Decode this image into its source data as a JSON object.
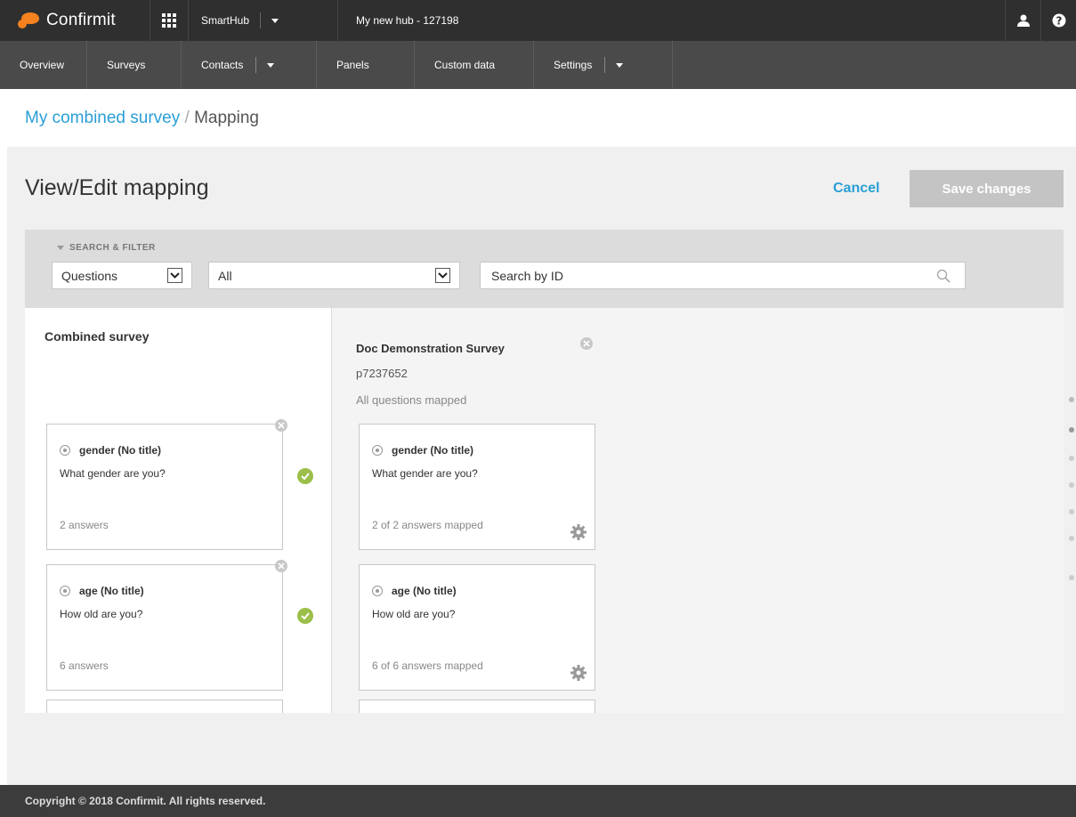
{
  "topbar": {
    "brand": "Confirmit",
    "hub_selector": "SmartHub",
    "hub_name": "My new hub - 127198",
    "icons": [
      "user-icon",
      "help-icon"
    ]
  },
  "nav": {
    "items": [
      {
        "label": "Overview",
        "has_dropdown": false
      },
      {
        "label": "Surveys",
        "has_dropdown": false
      },
      {
        "label": "Contacts",
        "has_dropdown": true
      },
      {
        "label": "Panels",
        "has_dropdown": false
      },
      {
        "label": "Custom data",
        "has_dropdown": false
      },
      {
        "label": "Settings",
        "has_dropdown": true
      }
    ]
  },
  "breadcrumb": {
    "link": "My combined survey",
    "separator": " / ",
    "current": "Mapping"
  },
  "page": {
    "title": "View/Edit mapping",
    "cancel_label": "Cancel",
    "save_label": "Save changes"
  },
  "filter": {
    "title": "SEARCH & FILTER",
    "type_select": "Questions",
    "scope_select": "All",
    "search_placeholder": "Search by ID"
  },
  "left": {
    "title": "Combined survey",
    "cards": [
      {
        "id": "gender (No title)",
        "text": "What gender are you?",
        "footer": "2 answers",
        "mapped": true
      },
      {
        "id": "age (No title)",
        "text": "How old are you?",
        "footer": "6 answers",
        "mapped": true
      }
    ]
  },
  "right": {
    "survey_name": "Doc Demonstration Survey",
    "survey_id": "p7237652",
    "status": "All questions mapped",
    "cards": [
      {
        "id": "gender (No title)",
        "text": "What gender are you?",
        "footer": "2 of 2 answers mapped"
      },
      {
        "id": "age (No title)",
        "text": "How old are you?",
        "footer": "6 of 6 answers mapped"
      }
    ]
  },
  "footer": {
    "copyright": "Copyright © 2018 Confirmit. All rights reserved."
  },
  "colors": {
    "link": "#2a9fd6",
    "brand_orange": "#f5821f",
    "check_green": "#9bbf4a",
    "topbar": "#2f2f2f",
    "navbar": "#4a4a4a"
  }
}
